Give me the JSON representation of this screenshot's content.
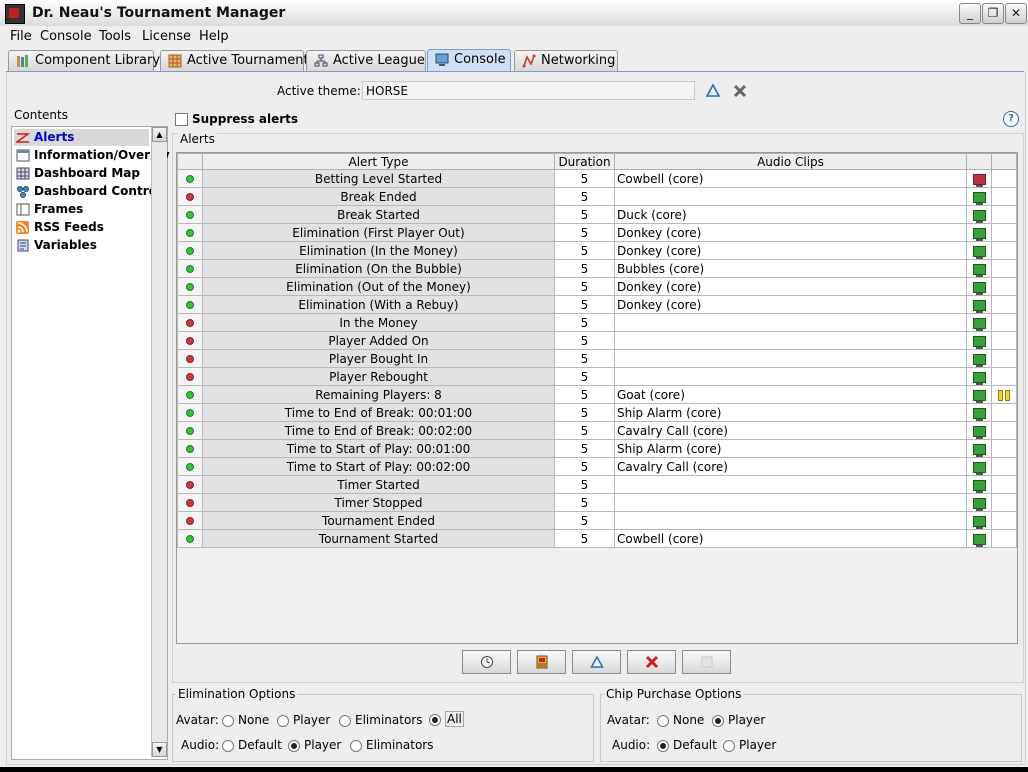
{
  "window": {
    "title": "Dr. Neau's Tournament Manager"
  },
  "menu": [
    "File",
    "Console",
    "Tools",
    "License",
    "Help"
  ],
  "tabs": [
    {
      "label": "Component Library",
      "icon": "books-icon"
    },
    {
      "label": "Active Tournament",
      "icon": "grid-icon"
    },
    {
      "label": "Active League",
      "icon": "league-icon"
    },
    {
      "label": "Console",
      "icon": "monitor-icon",
      "active": true
    },
    {
      "label": "Networking",
      "icon": "network-icon"
    }
  ],
  "theme": {
    "label": "Active theme:",
    "value": "HORSE"
  },
  "contents": {
    "label": "Contents",
    "items": [
      {
        "label": "Alerts",
        "icon": "alert-icon",
        "selected": true
      },
      {
        "label": "Information/Overlay",
        "icon": "overlay-icon"
      },
      {
        "label": "Dashboard Map",
        "icon": "dashboard-map-icon"
      },
      {
        "label": "Dashboard Control",
        "icon": "dashboard-control-icon"
      },
      {
        "label": "Frames",
        "icon": "frames-icon"
      },
      {
        "label": "RSS Feeds",
        "icon": "rss-icon"
      },
      {
        "label": "Variables",
        "icon": "variables-icon"
      }
    ]
  },
  "suppress": {
    "label": "Suppress alerts",
    "checked": false
  },
  "alerts": {
    "title": "Alerts",
    "columns": {
      "type": "Alert Type",
      "duration": "Duration",
      "clips": "Audio Clips"
    },
    "rows": [
      {
        "enabled": true,
        "type": "Betting Level Started",
        "duration": "5",
        "clip": "Cowbell (core)",
        "monitor": "red",
        "pause": false
      },
      {
        "enabled": false,
        "type": "Break Ended",
        "duration": "5",
        "clip": "",
        "monitor": "green",
        "pause": false
      },
      {
        "enabled": true,
        "type": "Break Started",
        "duration": "5",
        "clip": "Duck (core)",
        "monitor": "green",
        "pause": false
      },
      {
        "enabled": true,
        "type": "Elimination (First Player Out)",
        "duration": "5",
        "clip": "Donkey (core)",
        "monitor": "green",
        "pause": false
      },
      {
        "enabled": true,
        "type": "Elimination (In the Money)",
        "duration": "5",
        "clip": "Donkey (core)",
        "monitor": "green",
        "pause": false
      },
      {
        "enabled": true,
        "type": "Elimination (On the Bubble)",
        "duration": "5",
        "clip": "Bubbles (core)",
        "monitor": "green",
        "pause": false
      },
      {
        "enabled": true,
        "type": "Elimination (Out of the Money)",
        "duration": "5",
        "clip": "Donkey (core)",
        "monitor": "green",
        "pause": false
      },
      {
        "enabled": true,
        "type": "Elimination (With a Rebuy)",
        "duration": "5",
        "clip": "Donkey (core)",
        "monitor": "green",
        "pause": false
      },
      {
        "enabled": false,
        "type": "In the Money",
        "duration": "5",
        "clip": "",
        "monitor": "green",
        "pause": false
      },
      {
        "enabled": false,
        "type": "Player Added On",
        "duration": "5",
        "clip": "",
        "monitor": "green",
        "pause": false
      },
      {
        "enabled": false,
        "type": "Player Bought In",
        "duration": "5",
        "clip": "",
        "monitor": "green",
        "pause": false
      },
      {
        "enabled": false,
        "type": "Player Rebought",
        "duration": "5",
        "clip": "",
        "monitor": "green",
        "pause": false
      },
      {
        "enabled": true,
        "type": "Remaining Players: 8",
        "duration": "5",
        "clip": "Goat (core)",
        "monitor": "green",
        "pause": true
      },
      {
        "enabled": true,
        "type": "Time to End of Break: 00:01:00",
        "duration": "5",
        "clip": "Ship Alarm (core)",
        "monitor": "green",
        "pause": false
      },
      {
        "enabled": true,
        "type": "Time to End of Break: 00:02:00",
        "duration": "5",
        "clip": "Cavalry Call (core)",
        "monitor": "green",
        "pause": false
      },
      {
        "enabled": true,
        "type": "Time to Start of Play: 00:01:00",
        "duration": "5",
        "clip": "Ship Alarm (core)",
        "monitor": "green",
        "pause": false
      },
      {
        "enabled": true,
        "type": "Time to Start of Play: 00:02:00",
        "duration": "5",
        "clip": "Cavalry Call (core)",
        "monitor": "green",
        "pause": false
      },
      {
        "enabled": false,
        "type": "Timer Started",
        "duration": "5",
        "clip": "",
        "monitor": "green",
        "pause": false
      },
      {
        "enabled": false,
        "type": "Timer Stopped",
        "duration": "5",
        "clip": "",
        "monitor": "green",
        "pause": false
      },
      {
        "enabled": false,
        "type": "Tournament Ended",
        "duration": "5",
        "clip": "",
        "monitor": "green",
        "pause": false
      },
      {
        "enabled": true,
        "type": "Tournament Started",
        "duration": "5",
        "clip": "Cowbell (core)",
        "monitor": "green",
        "pause": false
      }
    ],
    "buttons": [
      "clock-icon",
      "film-icon",
      "delta-icon",
      "delete-icon",
      "blank-icon"
    ]
  },
  "elimination": {
    "title": "Elimination Options",
    "avatar_label": "Avatar:",
    "avatar_options": [
      "None",
      "Player",
      "Eliminators",
      "All"
    ],
    "avatar_selected": "All",
    "audio_label": "Audio:",
    "audio_options": [
      "Default",
      "Player",
      "Eliminators"
    ],
    "audio_selected": "Player"
  },
  "chip": {
    "title": "Chip Purchase Options",
    "avatar_label": "Avatar:",
    "avatar_options": [
      "None",
      "Player"
    ],
    "avatar_selected": "Player",
    "audio_label": "Audio:",
    "audio_options": [
      "Default",
      "Player"
    ],
    "audio_selected": "Default"
  },
  "colors": {
    "accent": "#7a9cc6",
    "enabled": "#3cbc3c",
    "disabled": "#c43c3c",
    "selected_text": "#0000cc"
  }
}
